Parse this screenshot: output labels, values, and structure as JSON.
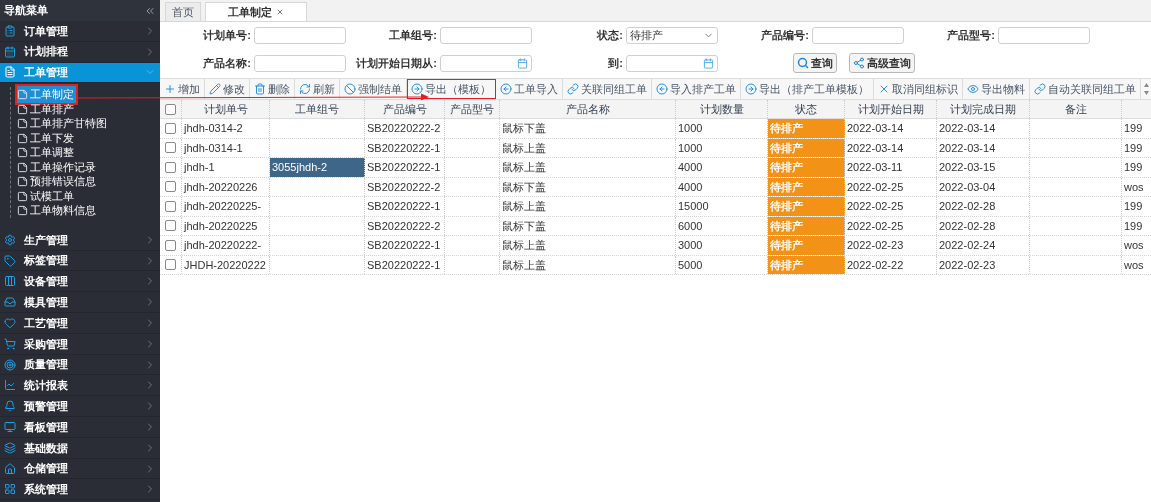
{
  "sidebar": {
    "title": "导航菜单",
    "items": [
      {
        "label": "订单管理",
        "expanded": false
      },
      {
        "label": "计划排程",
        "expanded": false
      },
      {
        "label": "工单管理",
        "expanded": true,
        "children": [
          {
            "label": "工单制定",
            "selected": true,
            "highlighted": true
          },
          {
            "label": "工单排产",
            "selected": false,
            "highlighted": false
          },
          {
            "label": "工单排产甘特图",
            "selected": false,
            "highlighted": false
          },
          {
            "label": "工单下发",
            "selected": false,
            "highlighted": false
          },
          {
            "label": "工单调整",
            "selected": false,
            "highlighted": false
          },
          {
            "label": "工单操作记录",
            "selected": false,
            "highlighted": false
          },
          {
            "label": "预排错误信息",
            "selected": false,
            "highlighted": false
          },
          {
            "label": "试模工单",
            "selected": false,
            "highlighted": false
          },
          {
            "label": "工单物料信息",
            "selected": false,
            "highlighted": false
          }
        ]
      },
      {
        "label": "生产管理",
        "expanded": false
      },
      {
        "label": "标签管理",
        "expanded": false
      },
      {
        "label": "设备管理",
        "expanded": false
      },
      {
        "label": "模具管理",
        "expanded": false
      },
      {
        "label": "工艺管理",
        "expanded": false
      },
      {
        "label": "采购管理",
        "expanded": false
      },
      {
        "label": "质量管理",
        "expanded": false
      },
      {
        "label": "统计报表",
        "expanded": false
      },
      {
        "label": "预警管理",
        "expanded": false
      },
      {
        "label": "看板管理",
        "expanded": false
      },
      {
        "label": "基础数据",
        "expanded": false
      },
      {
        "label": "仓储管理",
        "expanded": false
      },
      {
        "label": "系统管理",
        "expanded": false
      }
    ]
  },
  "tabs": [
    {
      "label": "首页",
      "selected": false,
      "closable": false
    },
    {
      "label": "工单制定",
      "selected": true,
      "closable": true
    }
  ],
  "filters": [
    {
      "label": "计划单号:",
      "kind": "text"
    },
    {
      "label": "工单组号:",
      "kind": "text"
    },
    {
      "label": "状态:",
      "kind": "select",
      "value": "待排产"
    },
    {
      "label": "产品编号:",
      "kind": "text"
    },
    {
      "label": "产品型号:",
      "kind": "text"
    },
    {
      "label": "产品名称:",
      "kind": "text"
    },
    {
      "label": "计划开始日期从:",
      "kind": "date"
    },
    {
      "label": "到:",
      "kind": "date"
    }
  ],
  "search_buttons": [
    "查询",
    "高级查询"
  ],
  "toolbar": [
    {
      "label": "增加",
      "highlighted": false
    },
    {
      "label": "修改",
      "highlighted": false
    },
    {
      "label": "删除",
      "highlighted": false
    },
    {
      "label": "刷新",
      "highlighted": false
    },
    {
      "label": "强制结单",
      "highlighted": false
    },
    {
      "label": "导出（模板）",
      "highlighted": true
    },
    {
      "label": "工单导入",
      "highlighted": false
    },
    {
      "label": "关联同组工单",
      "highlighted": false
    },
    {
      "label": "导入排产工单",
      "highlighted": false
    },
    {
      "label": "导出（排产工单模板）",
      "highlighted": false
    },
    {
      "label": "取消同组标识",
      "highlighted": false
    },
    {
      "label": "导出物料",
      "highlighted": false
    },
    {
      "label": "自动关联同组工单",
      "highlighted": false
    }
  ],
  "table": {
    "all_checked": false,
    "columns": [
      "计划单号",
      "工单组号",
      "产品编号",
      "产品型号",
      "产品名称",
      "计划数量",
      "状态",
      "计划开始日期",
      "计划完成日期",
      "备注"
    ],
    "rows": [
      {
        "checked": false,
        "plan_no": "jhdh-0314-2",
        "product_code": "SB20220222-2",
        "product_name": "鼠标下盖",
        "quantity": "1000",
        "status": "待排产",
        "start": "2022-03-14",
        "end": "2022-03-14",
        "column_11": "199"
      },
      {
        "checked": false,
        "plan_no": "jhdh-0314-1",
        "product_code": "SB20220222-1",
        "product_name": "鼠标上盖",
        "quantity": "1000",
        "status": "待排产",
        "start": "2022-03-14",
        "end": "2022-03-14",
        "column_11": "199"
      },
      {
        "checked": false,
        "plan_no": "jhdh-1",
        "group_no": {
          "text": "3055jhdh-2",
          "selected": true
        },
        "product_code": "SB20220222-1",
        "product_name": "鼠标上盖",
        "quantity": "4000",
        "status": "待排产",
        "start": "2022-03-11",
        "end": "2022-03-15",
        "column_11": "199"
      },
      {
        "checked": false,
        "plan_no": "jhdh-20220226",
        "product_code": "SB20220222-2",
        "product_name": "鼠标下盖",
        "quantity": "4000",
        "status": "待排产",
        "start": "2022-02-25",
        "end": "2022-03-04",
        "column_11": "wos"
      },
      {
        "checked": false,
        "plan_no": "jhdh-20220225-",
        "product_code": "SB20220222-1",
        "product_name": "鼠标上盖",
        "quantity": "15000",
        "status": "待排产",
        "start": "2022-02-25",
        "end": "2022-02-28",
        "column_11": "199"
      },
      {
        "checked": false,
        "plan_no": "jhdh-20220225",
        "product_code": "SB20220222-2",
        "product_name": "鼠标下盖",
        "quantity": "6000",
        "status": "待排产",
        "start": "2022-02-25",
        "end": "2022-02-28",
        "column_11": "199"
      },
      {
        "checked": false,
        "plan_no": "jhdh-20220222-",
        "product_code": "SB20220222-1",
        "product_name": "鼠标上盖",
        "quantity": "3000",
        "status": "待排产",
        "start": "2022-02-23",
        "end": "2022-02-24",
        "column_11": "wos"
      },
      {
        "checked": false,
        "plan_no": "JHDH-20220222",
        "product_code": "SB20220222-1",
        "product_name": "鼠标上盖",
        "quantity": "5000",
        "status": "待排产",
        "start": "2022-02-22",
        "end": "2022-02-23",
        "column_11": "wos"
      }
    ]
  }
}
